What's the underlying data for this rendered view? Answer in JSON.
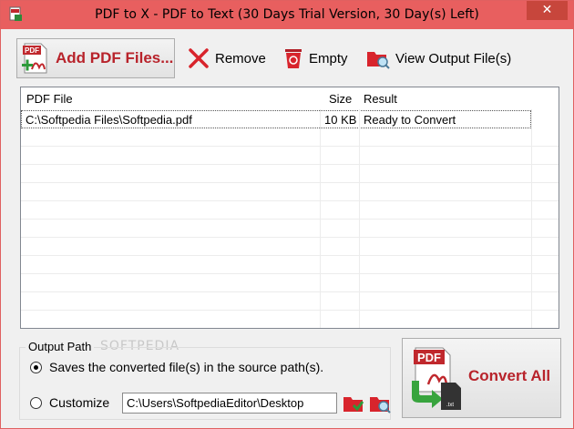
{
  "window": {
    "title": "PDF to X - PDF to Text (30 Days Trial Version, 30 Day(s) Left)",
    "close_glyph": "✕",
    "app_icon": "app-pdf-icon"
  },
  "toolbar": {
    "add_label": "Add PDF Files...",
    "remove_label": "Remove",
    "empty_label": "Empty",
    "view_label": "View Output File(s)"
  },
  "list": {
    "columns": [
      "PDF File",
      "Size",
      "Result"
    ],
    "rows": [
      {
        "file": "C:\\Softpedia Files\\Softpedia.pdf",
        "size": "10 KB",
        "result": "Ready to Convert"
      }
    ]
  },
  "output": {
    "group_label": "Output Path",
    "source_label": "Saves the converted file(s) in the source path(s).",
    "customize_label": "Customize",
    "path_value": "C:\\Users\\SoftpediaEditor\\Desktop",
    "selected": "source"
  },
  "convert": {
    "label": "Convert All"
  },
  "watermark": "SOFTPEDIA",
  "colors": {
    "titlebar": "#e85f5f",
    "accent_red": "#b8232b",
    "close": "#c7463c"
  }
}
